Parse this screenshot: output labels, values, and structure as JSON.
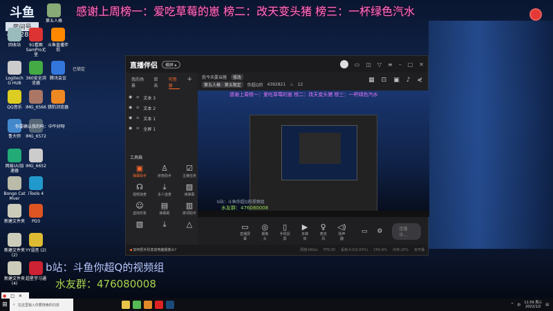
{
  "banner": "感谢上周榜一：爱吃草莓的崽 榜二：改天变头猪 榜三：一杯绿色汽水",
  "logo": {
    "brand": "斗鱼",
    "room_label": "房间号",
    "room_number": "4392821"
  },
  "desktop_icons": [
    {
      "label": "回收站",
      "color": "#9bb"
    },
    {
      "label": "91看图 SamPro尤里",
      "color": "#d33"
    },
    {
      "label": "斗鱼直播伴侣",
      "color": "#f80"
    },
    {
      "label": "Logitech G HUB",
      "color": "#ccc"
    },
    {
      "label": "360安全浏览器",
      "color": "#4a4"
    },
    {
      "label": "腾讯会议",
      "color": "#37d"
    },
    {
      "label": "QQ音乐",
      "color": "#dc2"
    },
    {
      "label": "IMG_6566",
      "color": "#a76"
    },
    {
      "label": "猎豹浏览器",
      "color": "#e82"
    },
    {
      "label": "鲁大师",
      "color": "#48c"
    },
    {
      "label": "IMG_6572",
      "color": "#567"
    },
    {
      "label": "网易UU加速器",
      "color": "#2a7"
    },
    {
      "label": "IMG_6652",
      "color": "#ccc"
    },
    {
      "label": "Bongo Cat Mver",
      "color": "#bba"
    },
    {
      "label": "iTools 4",
      "color": "#29c"
    },
    {
      "label": "新建文件夹",
      "color": "#ccb"
    },
    {
      "label": "PD3",
      "color": "#d52"
    },
    {
      "label": "新建文件夹 (2)",
      "color": "#ccb"
    },
    {
      "label": "YY语音 (2)",
      "color": "#db3"
    },
    {
      "label": "新建文件夹 (4)",
      "color": "#ccb"
    },
    {
      "label": "超星学习通",
      "color": "#c23"
    }
  ],
  "desktop_extra": {
    "top_icon": "第五人格",
    "locked": "已锁定",
    "chat": "你要确认我的吗：中午好呀"
  },
  "app": {
    "brand": "直播伴侣",
    "pill": "横屏 ▸",
    "left_tabs": [
      "我的场景",
      "双击",
      "可用源"
    ],
    "sources": [
      {
        "name": "文本 3"
      },
      {
        "name": "文本 2"
      },
      {
        "name": "文本 1"
      },
      {
        "name": "全屏 1"
      }
    ],
    "tools_title": "工具箱",
    "tools": [
      "弹幕助手",
      "房管助手",
      "主播任务",
      "视频连麦",
      "多人连麦",
      "读弹幕",
      "虚拟形象",
      "弹幕姬",
      "歌词助手",
      "",
      "",
      ""
    ],
    "stream_title": "我今天要当猪",
    "edit": "修改",
    "category": "第五人格 · 第五限定",
    "nick": "你超Q的",
    "room": "4392821",
    "fans": "12",
    "preview_b": "b站：斗鱼你超Q的视频组",
    "preview_q": "水友群：476080008",
    "controls": [
      "直播屏幕",
      "摄像头",
      "手机投屏",
      "多媒体",
      "麦克风",
      "扬声器"
    ],
    "live_button": "连播中...",
    "status": {
      "tip": "如何把手机变成电脑摄像头?",
      "net": "网络:0Kb/s",
      "fps": "FPS:30",
      "drop": "丢帧:0.0(0.00%)",
      "cpu": "CPU:6%",
      "mem": "内存:20%",
      "quality": "未开播"
    }
  },
  "overlay": {
    "bilibili": "b站：斗鱼你超Q的视频组",
    "qq_group": "水友群：476080008"
  },
  "taskbar": {
    "search_placeholder": "在这里输入你要搜索的内容",
    "time": "11:59 周三",
    "date": "2022/1/2",
    "ime": "中"
  }
}
